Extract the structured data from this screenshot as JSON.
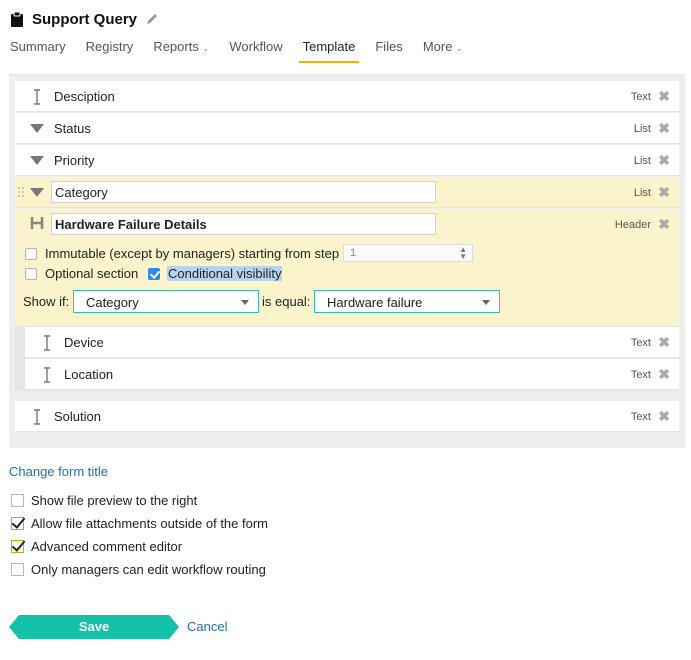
{
  "header": {
    "title": "Support Query"
  },
  "tabs": [
    {
      "label": "Summary"
    },
    {
      "label": "Registry"
    },
    {
      "label": "Reports",
      "has_dropdown": true
    },
    {
      "label": "Workflow"
    },
    {
      "label": "Template",
      "active": true
    },
    {
      "label": "Files"
    },
    {
      "label": "More",
      "has_dropdown": true
    }
  ],
  "fields": {
    "description": {
      "label": "Desciption",
      "type": "Text"
    },
    "status": {
      "label": "Status",
      "type": "List"
    },
    "priority": {
      "label": "Priority",
      "type": "List"
    },
    "category": {
      "value": "Category",
      "type": "List"
    },
    "header_field": {
      "value": "Hardware Failure Details",
      "type": "Header"
    },
    "device": {
      "label": "Device",
      "type": "Text"
    },
    "location": {
      "label": "Location",
      "type": "Text"
    },
    "solution": {
      "label": "Solution",
      "type": "Text"
    }
  },
  "header_options": {
    "immutable_label": "Immutable (except by managers) starting from step",
    "step_value": "1",
    "optional_label": "Optional section",
    "conditional_label": "Conditional visibility",
    "conditional_checked": true,
    "show_if_label": "Show if:",
    "condition_field": "Category",
    "is_equal_label": "is equal:",
    "condition_value": "Hardware failure"
  },
  "form_settings": {
    "change_title_link": "Change form title",
    "options": [
      {
        "label": "Show file preview to the right",
        "checked": false
      },
      {
        "label": "Allow file attachments outside of the form",
        "checked": true
      },
      {
        "label": "Advanced comment editor",
        "checked": true
      },
      {
        "label": "Only managers can edit workflow routing",
        "checked": false
      }
    ]
  },
  "actions": {
    "save": "Save",
    "cancel": "Cancel"
  },
  "colors": {
    "accent_tab": "#f0b400",
    "highlight": "#fbf3cc",
    "save": "#15c1a8",
    "link": "#1f6fb5",
    "select_border": "#3dbbb0"
  }
}
